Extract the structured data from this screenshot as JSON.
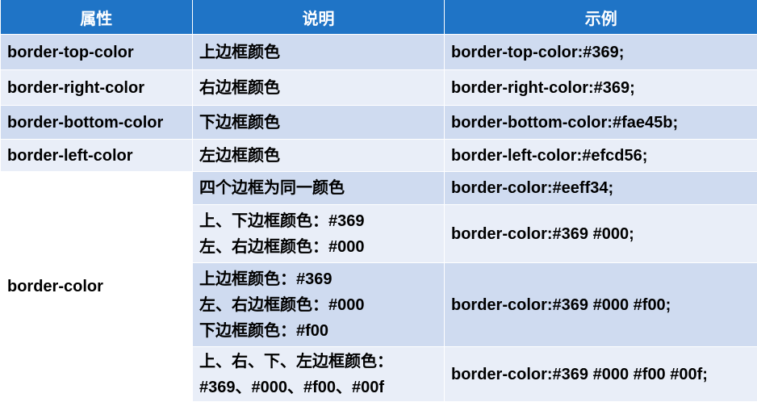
{
  "headers": [
    "属性",
    "说明",
    "示例"
  ],
  "rows": [
    {
      "prop": "border-top-color",
      "desc": [
        "上边框颜色"
      ],
      "example": "border-top-color:#369;"
    },
    {
      "prop": "border-right-color",
      "desc": [
        "右边框颜色"
      ],
      "example": "border-right-color:#369;"
    },
    {
      "prop": "border-bottom-color",
      "desc": [
        "下边框颜色"
      ],
      "example": "border-bottom-color:#fae45b;"
    },
    {
      "prop": "border-left-color",
      "desc": [
        "左边框颜色"
      ],
      "example": "border-left-color:#efcd56;"
    },
    {
      "prop": "border-color",
      "desc": [
        "四个边框为同一颜色"
      ],
      "example": "border-color:#eeff34;"
    },
    {
      "prop": "",
      "desc": [
        "上、下边框颜色：#369",
        "左、右边框颜色：#000"
      ],
      "example": "border-color:#369 #000;"
    },
    {
      "prop": "",
      "desc": [
        "上边框颜色：#369",
        "左、右边框颜色：#000",
        "下边框颜色：#f00"
      ],
      "example": "border-color:#369 #000 #f00;"
    },
    {
      "prop": "",
      "desc": [
        "上、右、下、左边框颜色：",
        "#369、#000、#f00、#00f"
      ],
      "example": "border-color:#369 #000 #f00 #00f;"
    }
  ]
}
